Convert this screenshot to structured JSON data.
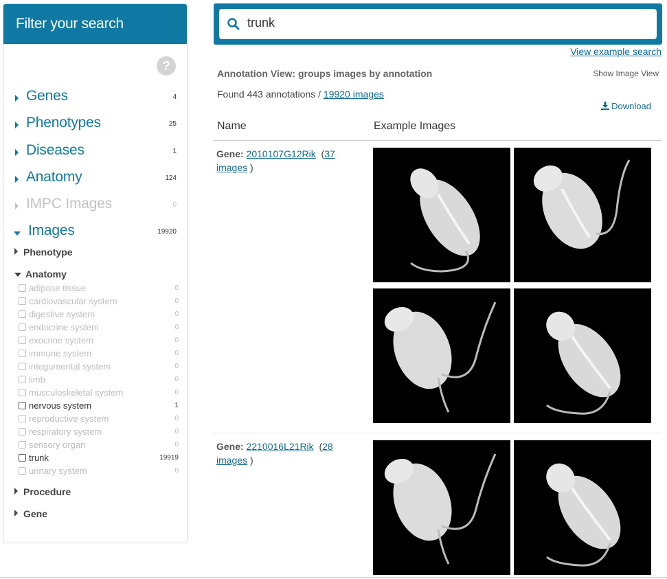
{
  "sidebar": {
    "title": "Filter your search",
    "facets": [
      {
        "label": "Genes",
        "count": "4"
      },
      {
        "label": "Phenotypes",
        "count": "25"
      },
      {
        "label": "Diseases",
        "count": "1"
      },
      {
        "label": "Anatomy",
        "count": "124"
      },
      {
        "label": "IMPC Images",
        "count": "0"
      },
      {
        "label": "Images",
        "count": "19920"
      }
    ],
    "subfacets": {
      "phenotype": "Phenotype",
      "anatomy": "Anatomy",
      "procedure": "Procedure",
      "gene": "Gene"
    },
    "anatomy_items": [
      {
        "label": "adipose tissue",
        "count": "0"
      },
      {
        "label": "cardiovascular system",
        "count": "0"
      },
      {
        "label": "digestive system",
        "count": "0"
      },
      {
        "label": "endocrine system",
        "count": "0"
      },
      {
        "label": "exocrine system",
        "count": "0"
      },
      {
        "label": "immune system",
        "count": "0"
      },
      {
        "label": "integumental system",
        "count": "0"
      },
      {
        "label": "limb",
        "count": "0"
      },
      {
        "label": "musculoskeletal system",
        "count": "0"
      },
      {
        "label": "nervous system",
        "count": "1"
      },
      {
        "label": "reproductive system",
        "count": "0"
      },
      {
        "label": "respiratory system",
        "count": "0"
      },
      {
        "label": "sensory organ",
        "count": "0"
      },
      {
        "label": "trunk",
        "count": "19919"
      },
      {
        "label": "urinary system",
        "count": "0"
      }
    ]
  },
  "search": {
    "value": "trunk"
  },
  "view_example_label": "View example search",
  "annotation_view_title": "Annotation View: groups images by annotation",
  "show_image_view_label": "Show Image View",
  "found": {
    "prefix": "Found 443 annotations / ",
    "images_link": "19920 images"
  },
  "download_label": "Download",
  "table": {
    "col_name": "Name",
    "col_examples": "Example Images",
    "rows": [
      {
        "prefix": "Gene:",
        "gene": "2010107G12Rik",
        "count_link_1": "37",
        "count_link_2": "images",
        "suffix": ")"
      },
      {
        "prefix": "Gene:",
        "gene": "2210016L21Rik",
        "count_link_1": "28",
        "count_link_2": "images",
        "suffix": ")"
      }
    ]
  },
  "colors": {
    "accent": "#0f79a3",
    "link": "#0f6a93"
  }
}
